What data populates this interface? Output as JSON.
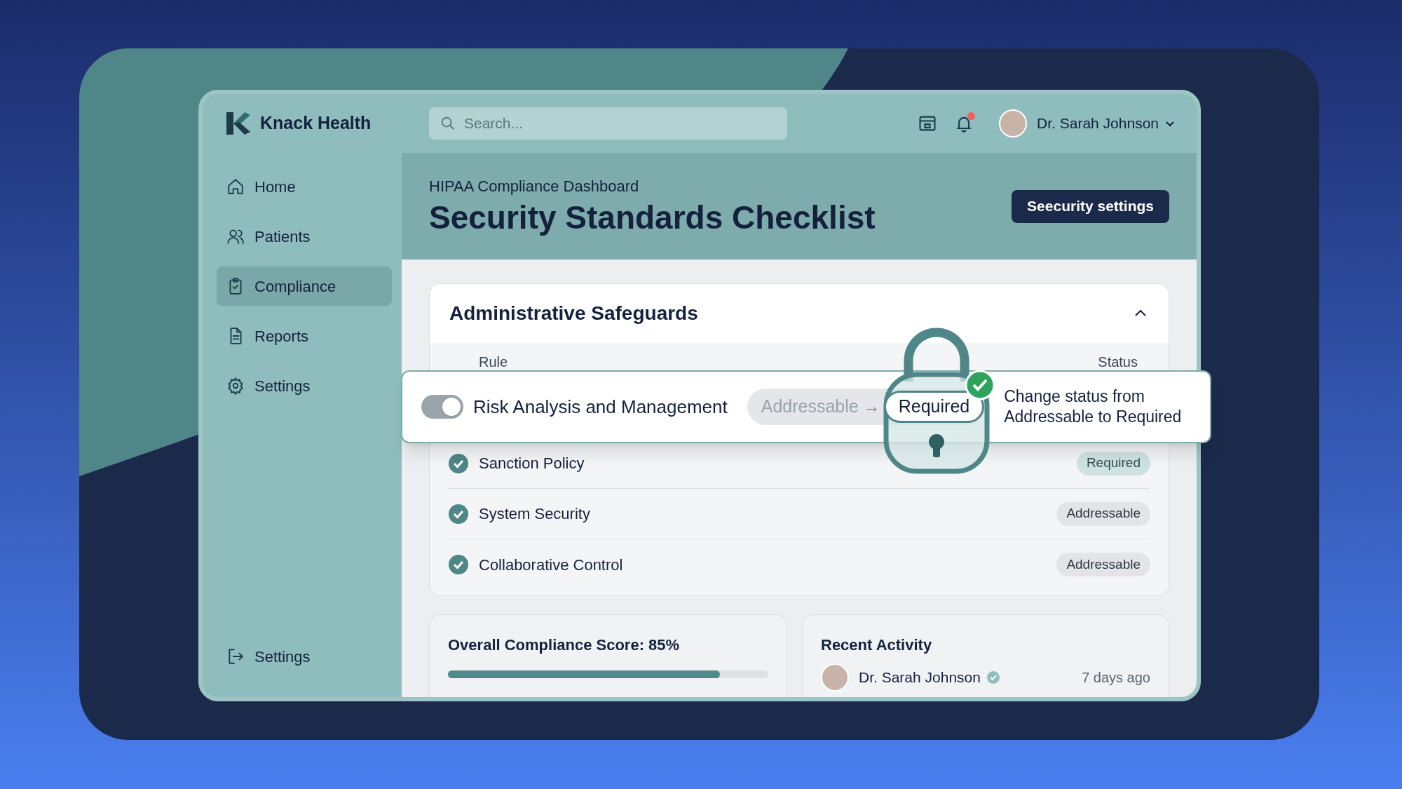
{
  "app": {
    "name": "Knack Health"
  },
  "search": {
    "placeholder": "Search..."
  },
  "notifications": {
    "unread": true
  },
  "user": {
    "name": "Dr. Sarah Johnson"
  },
  "sidebar": {
    "items": [
      {
        "label": "Home",
        "selected": false
      },
      {
        "label": "Patients",
        "selected": false
      },
      {
        "label": "Compliance",
        "selected": true
      },
      {
        "label": "Reports",
        "selected": false
      },
      {
        "label": "Settings",
        "selected": false
      }
    ],
    "footer_item": {
      "label": "Settings"
    }
  },
  "page": {
    "breadcrumb": "HIPAA Compliance Dashboard",
    "title": "Security Standards Checklist",
    "action": "Seecurity settings"
  },
  "section": {
    "title": "Administrative Safeguards",
    "expanded": true,
    "columns": [
      "Rule",
      "Status"
    ],
    "rows": [
      {
        "rule": "Sanction Policy",
        "checked": true,
        "status": "Required",
        "kind": "required"
      },
      {
        "rule": "System Security",
        "checked": true,
        "status": "Addressable",
        "kind": "addressable"
      },
      {
        "rule": "Collaborative Control",
        "checked": true,
        "status": "Addressable",
        "kind": "addressable"
      }
    ]
  },
  "popup": {
    "toggle_on": true,
    "rule": "Risk Analysis and Management",
    "from_status": "Addressable",
    "arrow": "→",
    "to_status": "Required",
    "confirmed": true,
    "message": "Change status from Addressable to Required"
  },
  "score_card": {
    "title": "Overall Compliance Score: 85%",
    "level": 0.85
  },
  "activity": {
    "title": "Recent Activity",
    "items": [
      {
        "name": "Dr. Sarah Johnson",
        "verified": true,
        "time": "7 days ago"
      }
    ]
  }
}
